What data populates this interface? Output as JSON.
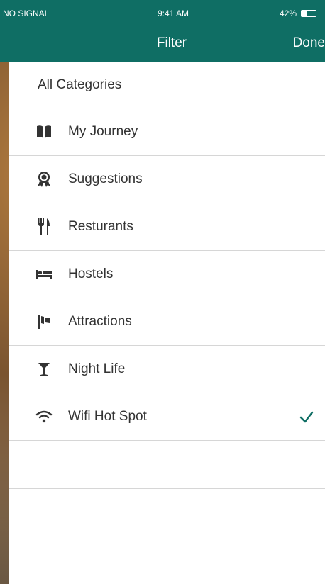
{
  "status_bar": {
    "carrier": "NO SIGNAL",
    "time": "9:41 AM",
    "battery": "42%",
    "battery_level": 0.42
  },
  "header": {
    "title": "Filter",
    "done_label": "Done"
  },
  "colors": {
    "header_bg": "#0f6e64",
    "check": "#0f6e64",
    "icon": "#333333"
  },
  "list": {
    "all_label": "All Categories",
    "items": [
      {
        "label": "My Journey",
        "icon": "book-icon",
        "selected": false
      },
      {
        "label": "Suggestions",
        "icon": "award-ribbon-icon",
        "selected": false
      },
      {
        "label": "Resturants",
        "icon": "fork-knife-icon",
        "selected": false
      },
      {
        "label": "Hostels",
        "icon": "bed-icon",
        "selected": false
      },
      {
        "label": "Attractions",
        "icon": "flag-icon",
        "selected": false
      },
      {
        "label": "Night Life",
        "icon": "cocktail-glass-icon",
        "selected": false
      },
      {
        "label": "Wifi Hot Spot",
        "icon": "wifi-icon",
        "selected": true
      }
    ]
  }
}
